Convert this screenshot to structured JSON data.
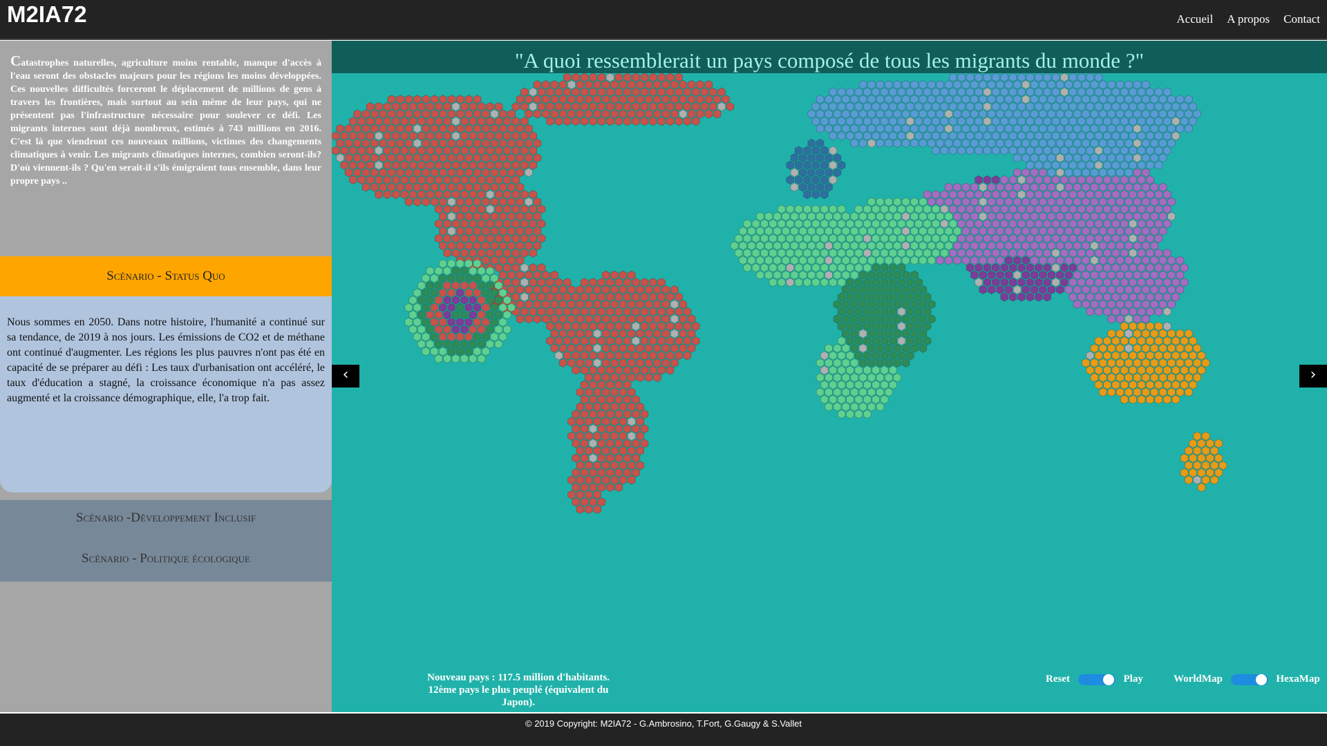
{
  "brand": "M2IA72",
  "nav": {
    "home": "Accueil",
    "about": "A propos",
    "contact": "Contact"
  },
  "sidebar": {
    "intro_dropcap": "C",
    "intro_text": "atastrophes naturelles, agriculture moins rentable, manque d'accès à l'eau seront des obstacles majeurs pour les régions les moins développées. Ces nouvelles difficultés forceront le déplacement de millions de gens à travers les frontières, mais surtout au sein même de leur pays, qui ne présentent pas l'infrastructure nécessaire pour soulever ce défi. Les migrants internes sont déjà nombreux, estimés à 743 millions en 2016. C'est là que viendront ces nouveaux millions, victimes des changements climatiques à venir. Les migrants climatiques internes, combien seront-ils? D'où viennent-ils ? Qu'en serait-il s'ils émigraient tous ensemble, dans leur propre pays ..",
    "active_scenario": {
      "label": "Scénario - Status Quo",
      "text": "Nous sommes en 2050. Dans notre histoire, l'humanité a continué sur sa tendance, de 2019 à nos jours. Les émissions de CO2 et de méthane ont continué d'augmenter. Les régions les plus pauvres n'ont pas été en capacité de se préparer au défi : Les taux d'urbanisation ont accéléré, le taux d'éducation a stagné, la croissance économique n'a pas assez augmenté et la croissance démographique, elle, l'a trop fait."
    },
    "other_scenarios": [
      "Scénario -Développement Inclusif",
      "Scénario - Politique écologique"
    ]
  },
  "map": {
    "title": "\"A quoi ressemblerait un pays composé de tous les migrants du monde ?\"",
    "prev_arrow": "‹",
    "next_arrow": "›",
    "stats_line1": "Nouveau pays : 117.5 million d'habitants.",
    "stats_line2": "12ème pays le plus peuplé (équivalent du Japon).",
    "controls": {
      "reset": "Reset",
      "play": "Play",
      "worldmap": "WorldMap",
      "hexamap": "HexaMap"
    },
    "colors": {
      "ocean": "#20b2aa",
      "americas": "#c9524a",
      "europe": "#5b9bd5",
      "europe_west": "#2f6fa0",
      "africa_north": "#5fd08f",
      "africa_central": "#2e8b57",
      "asia": "#a56cc1",
      "asia_south": "#7d3c98",
      "oceania": "#e89b17",
      "migrant": "#b0b0b0"
    }
  },
  "footer": {
    "copyright": "© 2019 Copyright: M2IA72 - G.Ambrosino, T.Fort, G.Gaugy & S.Vallet"
  }
}
